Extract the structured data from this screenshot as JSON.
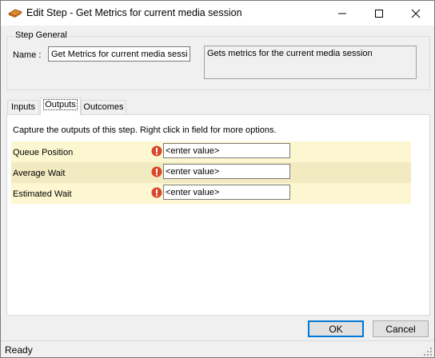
{
  "window": {
    "title": "Edit Step - Get Metrics for current media session",
    "icon": "step-icon"
  },
  "step_general": {
    "legend": "Step General",
    "name_label": "Name :",
    "name_value": "Get Metrics for current media session",
    "description": "Gets metrics for the current media session"
  },
  "tabs": [
    {
      "label": "Inputs",
      "selected": false
    },
    {
      "label": "Outputs",
      "selected": true
    },
    {
      "label": "Outcomes",
      "selected": false
    }
  ],
  "outputs": {
    "instructions": "Capture the outputs of this step.  Right click in field for more options.",
    "rows": [
      {
        "label": "Queue Position",
        "value": "<enter value>",
        "icon": "error-icon"
      },
      {
        "label": "Average Wait",
        "value": "<enter value>",
        "icon": "error-icon"
      },
      {
        "label": "Estimated Wait",
        "value": "<enter value>",
        "icon": "error-icon"
      }
    ]
  },
  "buttons": {
    "ok": "OK",
    "cancel": "Cancel"
  },
  "status": {
    "text": "Ready"
  },
  "colors": {
    "row_odd": "#fcf7d0",
    "row_even": "#f2eac0",
    "error": "#d9472b",
    "focus": "#0078d7"
  }
}
